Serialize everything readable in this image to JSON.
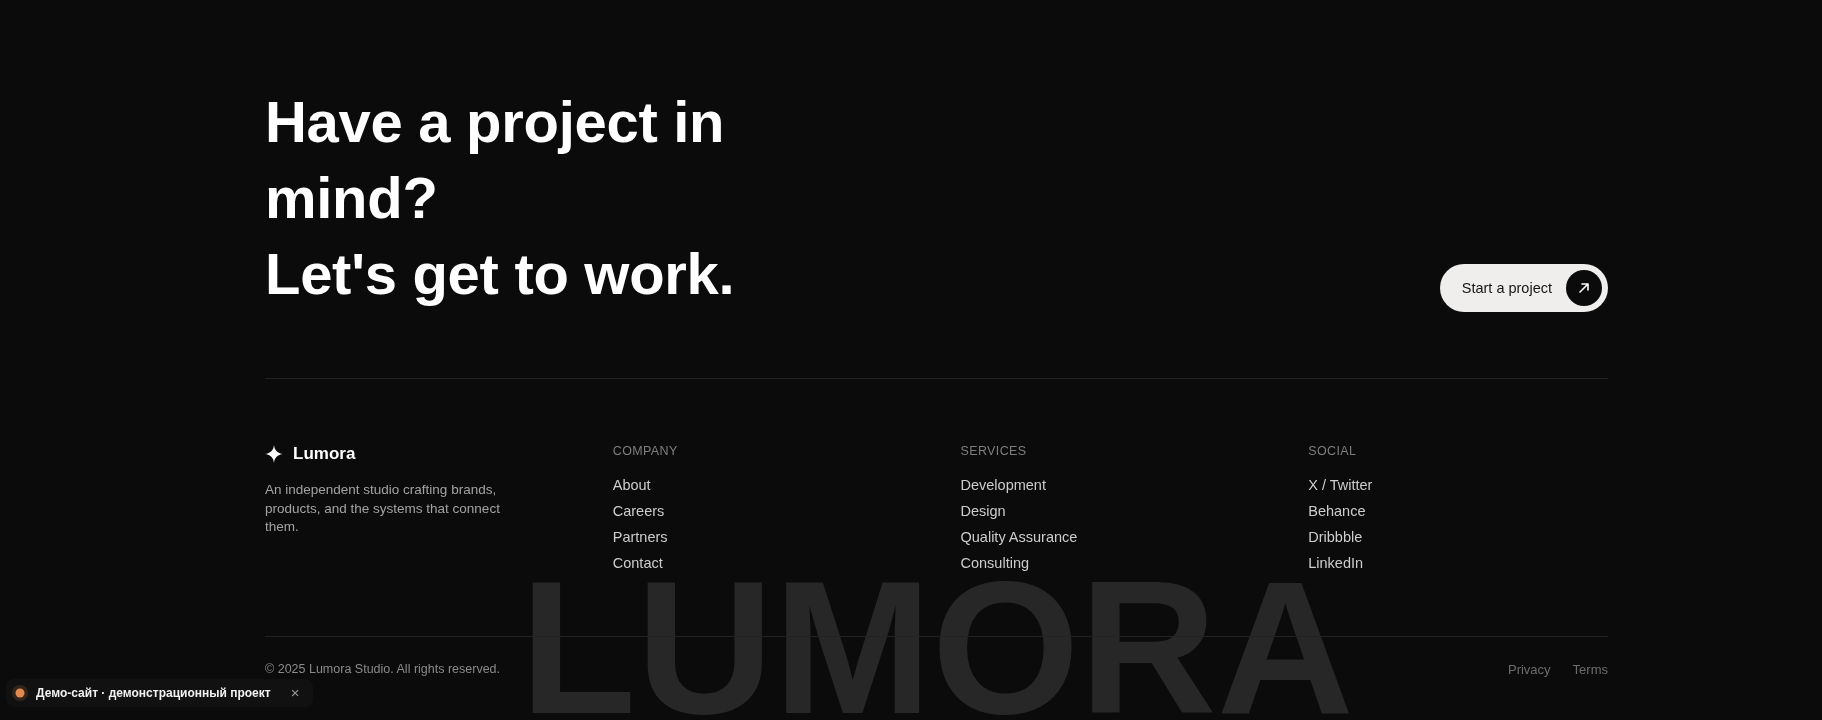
{
  "cta": {
    "headline": [
      "Have a project in mind?",
      "Let's get to work."
    ],
    "button": {
      "label": "Start a project"
    }
  },
  "footer": {
    "brand": {
      "name": "Lumora",
      "tagline": "An independent studio crafting brands, products, and the systems that connect them."
    },
    "columns": [
      {
        "title": "COMPANY",
        "links": [
          "About",
          "Careers",
          "Partners",
          "Contact"
        ]
      },
      {
        "title": "SERVICES",
        "links": [
          "Development",
          "Design",
          "Quality Assurance",
          "Consulting"
        ]
      },
      {
        "title": "SOCIAL",
        "links": [
          "X / Twitter",
          "Behance",
          "Dribbble",
          "LinkedIn"
        ]
      }
    ],
    "wordmark": "LUMORA",
    "bottom_bar": {
      "copyright": "© 2025 Lumora Studio. All rights reserved.",
      "links": [
        "Privacy",
        "Terms"
      ]
    }
  },
  "demo_banner": {
    "text": "Демо-сайт · демонстрационный проект",
    "close": "×"
  }
}
